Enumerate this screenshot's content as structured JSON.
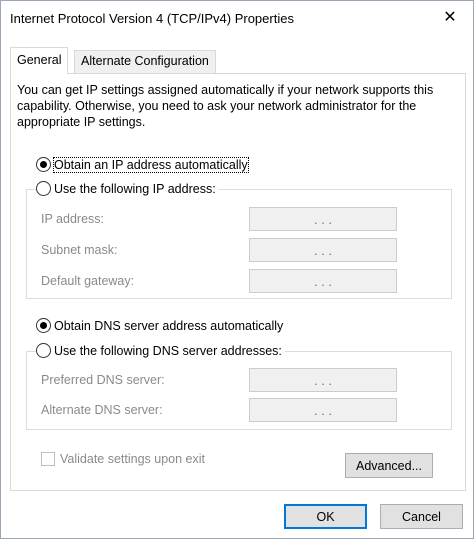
{
  "window": {
    "title": "Internet Protocol Version 4 (TCP/IPv4) Properties",
    "close_glyph": "✕"
  },
  "tabs": [
    {
      "label": "General"
    },
    {
      "label": "Alternate Configuration"
    }
  ],
  "description": "You can get IP settings assigned automatically if your network supports this capability. Otherwise, you need to ask your network administrator for the appropriate IP settings.",
  "ip_section": {
    "auto_label": "Obtain an IP address automatically",
    "manual_label": "Use the following IP address:",
    "fields": [
      {
        "label": "IP address:",
        "value": ". . ."
      },
      {
        "label": "Subnet mask:",
        "value": ". . ."
      },
      {
        "label": "Default gateway:",
        "value": ". . ."
      }
    ]
  },
  "dns_section": {
    "auto_label": "Obtain DNS server address automatically",
    "manual_label": "Use the following DNS server addresses:",
    "fields": [
      {
        "label": "Preferred DNS server:",
        "value": ". . ."
      },
      {
        "label": "Alternate DNS server:",
        "value": ". . ."
      }
    ]
  },
  "validate_label": "Validate settings upon exit",
  "buttons": {
    "advanced": "Advanced...",
    "ok": "OK",
    "cancel": "Cancel"
  }
}
